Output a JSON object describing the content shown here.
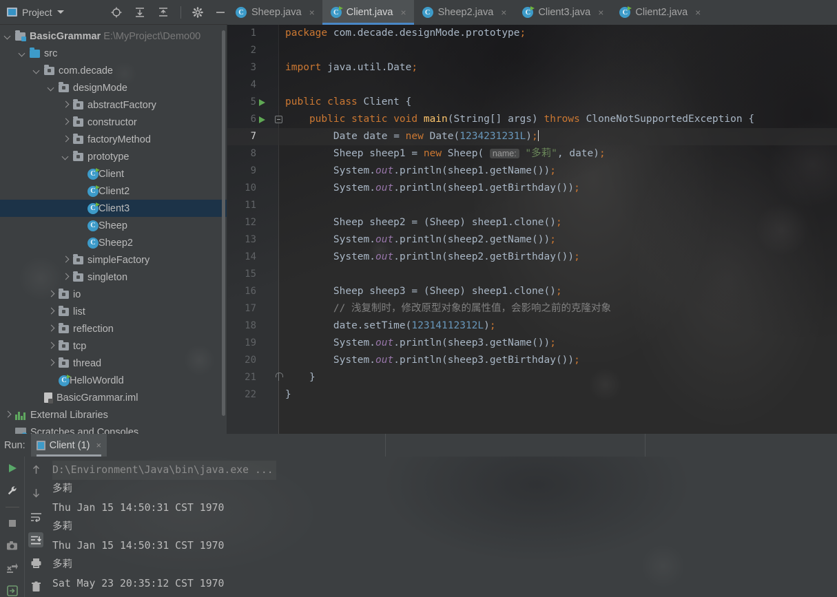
{
  "project_panel": {
    "title": "Project",
    "caret_icon": "chevron-down-icon",
    "toolbar": [
      {
        "name": "locate-target-icon",
        "tip": "Select Opened File"
      },
      {
        "name": "expand-all-icon",
        "tip": "Expand All"
      },
      {
        "name": "collapse-all-icon",
        "tip": "Collapse All"
      },
      {
        "name": "settings-gear-icon",
        "tip": "Settings"
      },
      {
        "name": "minimize-icon",
        "tip": "Hide"
      }
    ],
    "tree": [
      {
        "label": "BasicGrammar",
        "secondary": "E:\\MyProject\\Demo00",
        "depth": 0,
        "state": "open",
        "icon": "module-icon",
        "selected": false,
        "bold": true
      },
      {
        "label": "src",
        "secondary": "",
        "depth": 1,
        "state": "open",
        "icon": "source-folder-icon",
        "selected": false,
        "bold": false
      },
      {
        "label": "com.decade",
        "secondary": "",
        "depth": 2,
        "state": "open",
        "icon": "package-icon",
        "selected": false,
        "bold": false
      },
      {
        "label": "designMode",
        "secondary": "",
        "depth": 3,
        "state": "open",
        "icon": "package-icon",
        "selected": false,
        "bold": false
      },
      {
        "label": "abstractFactory",
        "secondary": "",
        "depth": 4,
        "state": "closed",
        "icon": "package-icon",
        "selected": false,
        "bold": false
      },
      {
        "label": "constructor",
        "secondary": "",
        "depth": 4,
        "state": "closed",
        "icon": "package-icon",
        "selected": false,
        "bold": false
      },
      {
        "label": "factoryMethod",
        "secondary": "",
        "depth": 4,
        "state": "closed",
        "icon": "package-icon",
        "selected": false,
        "bold": false
      },
      {
        "label": "prototype",
        "secondary": "",
        "depth": 4,
        "state": "open",
        "icon": "package-icon",
        "selected": false,
        "bold": false
      },
      {
        "label": "Client",
        "secondary": "",
        "depth": 5,
        "state": "leaf",
        "icon": "runnable-class-icon",
        "selected": false,
        "bold": false
      },
      {
        "label": "Client2",
        "secondary": "",
        "depth": 5,
        "state": "leaf",
        "icon": "runnable-class-icon",
        "selected": false,
        "bold": false
      },
      {
        "label": "Client3",
        "secondary": "",
        "depth": 5,
        "state": "leaf",
        "icon": "runnable-class-icon",
        "selected": true,
        "bold": false
      },
      {
        "label": "Sheep",
        "secondary": "",
        "depth": 5,
        "state": "leaf",
        "icon": "class-icon",
        "selected": false,
        "bold": false
      },
      {
        "label": "Sheep2",
        "secondary": "",
        "depth": 5,
        "state": "leaf",
        "icon": "class-icon",
        "selected": false,
        "bold": false
      },
      {
        "label": "simpleFactory",
        "secondary": "",
        "depth": 4,
        "state": "closed",
        "icon": "package-icon",
        "selected": false,
        "bold": false
      },
      {
        "label": "singleton",
        "secondary": "",
        "depth": 4,
        "state": "closed",
        "icon": "package-icon",
        "selected": false,
        "bold": false
      },
      {
        "label": "io",
        "secondary": "",
        "depth": 3,
        "state": "closed",
        "icon": "package-icon",
        "selected": false,
        "bold": false
      },
      {
        "label": "list",
        "secondary": "",
        "depth": 3,
        "state": "closed",
        "icon": "package-icon",
        "selected": false,
        "bold": false
      },
      {
        "label": "reflection",
        "secondary": "",
        "depth": 3,
        "state": "closed",
        "icon": "package-icon",
        "selected": false,
        "bold": false
      },
      {
        "label": "tcp",
        "secondary": "",
        "depth": 3,
        "state": "closed",
        "icon": "package-icon",
        "selected": false,
        "bold": false
      },
      {
        "label": "thread",
        "secondary": "",
        "depth": 3,
        "state": "closed",
        "icon": "package-icon",
        "selected": false,
        "bold": false
      },
      {
        "label": "HelloWordld",
        "secondary": "",
        "depth": 3,
        "state": "leaf",
        "icon": "runnable-class-icon",
        "selected": false,
        "bold": false
      },
      {
        "label": "BasicGrammar.iml",
        "secondary": "",
        "depth": 2,
        "state": "leaf",
        "icon": "iml-file-icon",
        "selected": false,
        "bold": false
      },
      {
        "label": "External Libraries",
        "secondary": "",
        "depth": 0,
        "state": "closed",
        "icon": "libraries-icon",
        "selected": false,
        "bold": false
      },
      {
        "label": "Scratches and Consoles",
        "secondary": "",
        "depth": 0,
        "state": "leaf",
        "icon": "scratches-icon",
        "selected": false,
        "bold": false
      }
    ]
  },
  "editor_tabs": [
    {
      "label": "Sheep.java",
      "icon": "class-icon",
      "active": false,
      "closable": true
    },
    {
      "label": "Client.java",
      "icon": "runnable-class-icon",
      "active": true,
      "closable": true
    },
    {
      "label": "Sheep2.java",
      "icon": "class-icon",
      "active": false,
      "closable": true
    },
    {
      "label": "Client3.java",
      "icon": "runnable-class-icon",
      "active": false,
      "closable": true
    },
    {
      "label": "Client2.java",
      "icon": "runnable-class-icon",
      "active": false,
      "closable": true
    }
  ],
  "editor": {
    "current_line": 7,
    "lines": [
      {
        "n": "1",
        "run": false,
        "fold": "",
        "cur": false,
        "text": "package com.decade.designMode.prototype;"
      },
      {
        "n": "2",
        "run": false,
        "fold": "",
        "cur": false,
        "text": ""
      },
      {
        "n": "3",
        "run": false,
        "fold": "",
        "cur": false,
        "text": "import java.util.Date;"
      },
      {
        "n": "4",
        "run": false,
        "fold": "",
        "cur": false,
        "text": ""
      },
      {
        "n": "5",
        "run": true,
        "fold": "",
        "cur": false,
        "text": "public class Client {"
      },
      {
        "n": "6",
        "run": true,
        "fold": "open",
        "cur": false,
        "text": "    public static void main(String[] args) throws CloneNotSupportedException {"
      },
      {
        "n": "7",
        "run": false,
        "fold": "",
        "cur": true,
        "text": "        Date date = new Date(1234231231L);"
      },
      {
        "n": "8",
        "run": false,
        "fold": "",
        "cur": false,
        "text": "        Sheep sheep1 = new Sheep( name: \"多莉\", date);"
      },
      {
        "n": "9",
        "run": false,
        "fold": "",
        "cur": false,
        "text": "        System.out.println(sheep1.getName());"
      },
      {
        "n": "10",
        "run": false,
        "fold": "",
        "cur": false,
        "text": "        System.out.println(sheep1.getBirthday());"
      },
      {
        "n": "11",
        "run": false,
        "fold": "",
        "cur": false,
        "text": ""
      },
      {
        "n": "12",
        "run": false,
        "fold": "",
        "cur": false,
        "text": "        Sheep sheep2 = (Sheep) sheep1.clone();"
      },
      {
        "n": "13",
        "run": false,
        "fold": "",
        "cur": false,
        "text": "        System.out.println(sheep2.getName());"
      },
      {
        "n": "14",
        "run": false,
        "fold": "",
        "cur": false,
        "text": "        System.out.println(sheep2.getBirthday());"
      },
      {
        "n": "15",
        "run": false,
        "fold": "",
        "cur": false,
        "text": ""
      },
      {
        "n": "16",
        "run": false,
        "fold": "",
        "cur": false,
        "text": "        Sheep sheep3 = (Sheep) sheep1.clone();"
      },
      {
        "n": "17",
        "run": false,
        "fold": "",
        "cur": false,
        "text": "        // 浅复制时，修改原型对象的属性值，会影响之前的克隆对象"
      },
      {
        "n": "18",
        "run": false,
        "fold": "",
        "cur": false,
        "text": "        date.setTime(12314112312L);"
      },
      {
        "n": "19",
        "run": false,
        "fold": "",
        "cur": false,
        "text": "        System.out.println(sheep3.getName());"
      },
      {
        "n": "20",
        "run": false,
        "fold": "",
        "cur": false,
        "text": "        System.out.println(sheep3.getBirthday());"
      },
      {
        "n": "21",
        "run": false,
        "fold": "end",
        "cur": false,
        "text": "    }"
      },
      {
        "n": "22",
        "run": false,
        "fold": "",
        "cur": false,
        "text": "}"
      }
    ],
    "param_hint": "name:"
  },
  "run_panel": {
    "label": "Run:",
    "tab_label": "Client (1)",
    "tab_close": "×",
    "left_tools": [
      {
        "name": "rerun-icon"
      },
      {
        "name": "wrench-settings-icon"
      },
      {
        "name": "stop-icon"
      },
      {
        "name": "camera-snapshot-icon"
      },
      {
        "name": "dump-threads-icon"
      },
      {
        "name": "export-icon"
      }
    ],
    "right_tools": [
      {
        "name": "arrow-up-icon"
      },
      {
        "name": "arrow-down-icon"
      },
      {
        "name": "soft-wrap-icon"
      },
      {
        "name": "scroll-to-end-icon",
        "active": true
      },
      {
        "name": "print-icon"
      },
      {
        "name": "trash-icon"
      }
    ],
    "console_lines": [
      {
        "text": "D:\\Environment\\Java\\bin\\java.exe ...",
        "kind": "command"
      },
      {
        "text": "多莉",
        "kind": "cjk"
      },
      {
        "text": "Thu Jan 15 14:50:31 CST 1970",
        "kind": "out"
      },
      {
        "text": "多莉",
        "kind": "cjk"
      },
      {
        "text": "Thu Jan 15 14:50:31 CST 1970",
        "kind": "out"
      },
      {
        "text": "多莉",
        "kind": "cjk"
      },
      {
        "text": "Sat May 23 20:35:12 CST 1970",
        "kind": "out"
      }
    ]
  },
  "colors": {
    "panel_bg": "#3c3f41",
    "editor_bg": "#2b2b2b",
    "selection_blue": "#1c3348",
    "tab_active_underline": "#4a88c7",
    "keyword_orange": "#cc7832",
    "string_green": "#6a8759",
    "number_blue": "#6897bb",
    "method_yellow": "#ffc66d",
    "static_purple": "#9876aa",
    "comment_gray": "#808080",
    "text_gray": "#a9b7c6",
    "run_green": "#5fa854"
  }
}
